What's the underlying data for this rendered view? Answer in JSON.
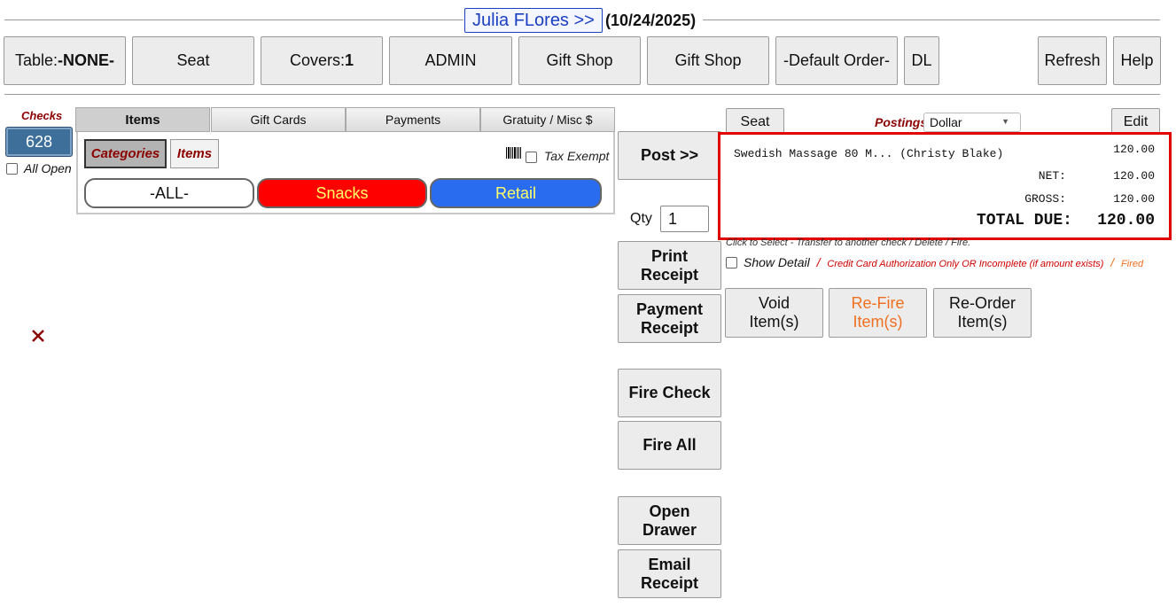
{
  "header": {
    "customer_link": "Julia FLores >>",
    "date": "(10/24/2025)",
    "colors": {
      "link": "#1a3fbf",
      "link_border": "#1a3fbf"
    }
  },
  "toolbar": {
    "table_label": "Table: ",
    "table_value": "-NONE-",
    "seat": "Seat",
    "covers_label": "Covers: ",
    "covers_value": "1",
    "admin": "ADMIN",
    "gift_shop_1": "Gift Shop",
    "gift_shop_2": "Gift Shop",
    "default_order": "-Default Order-",
    "dl": "DL",
    "refresh": "Refresh",
    "help": "Help"
  },
  "checks": {
    "title": "Checks",
    "check_number": "628",
    "all_open": "All Open",
    "colors": {
      "title": "#8b0000",
      "badge": "#3e6f9b"
    }
  },
  "tabs": [
    {
      "label": "Items",
      "active": true
    },
    {
      "label": "Gift Cards",
      "active": false
    },
    {
      "label": "Payments",
      "active": false
    },
    {
      "label": "Gratuity / Misc $",
      "active": false
    }
  ],
  "item_panel": {
    "categories_btn": "Categories",
    "items_btn": "Items",
    "barcode_icon": "barcode-icon",
    "tax_exempt": "Tax Exempt",
    "category_pills": [
      {
        "label": "-ALL-",
        "bg": "#ffffff",
        "color": "#111111"
      },
      {
        "label": "Snacks",
        "bg": "#ff0000",
        "color": "#ffff66"
      },
      {
        "label": "Retail",
        "bg": "#2a6cf0",
        "color": "#ffff66"
      }
    ]
  },
  "remove_icon": "close-x-icon",
  "actions": {
    "post": "Post >>",
    "qty_label": "Qty",
    "qty_value": "1",
    "print_receipt_1": "Print",
    "print_receipt_2": "Receipt",
    "payment_receipt_1": "Payment",
    "payment_receipt_2": "Receipt",
    "fire_check": "Fire Check",
    "fire_all": "Fire All",
    "open_drawer_1": "Open",
    "open_drawer_2": "Drawer",
    "email_receipt_1": "Email",
    "email_receipt_2": "Receipt"
  },
  "check_panel": {
    "seat": "Seat",
    "postings_label": "Postings",
    "postings_select": "Dollar",
    "edit": "Edit",
    "line_items": [
      {
        "description": "Swedish Massage 80 M... (Christy Blake)",
        "amount": "120.00"
      }
    ],
    "net_label": "NET:",
    "net_value": "120.00",
    "gross_label": "GROSS:",
    "gross_value": "120.00",
    "total_label": "TOTAL DUE:",
    "total_value": "120.00",
    "hint": "Click to Select - Transfer to another check / Delete / Fire.",
    "show_detail": "Show Detail",
    "legend_sep": "/",
    "legend_cc": "Credit Card Authorization Only OR Incomplete (if amount exists)",
    "legend_fired": "Fired",
    "colors": {
      "highlight_border": "#e00000",
      "cc": "#d00000",
      "fired": "#f07020"
    }
  },
  "item_actions": {
    "void_1": "Void",
    "void_2": "Item(s)",
    "refire_1": "Re-Fire",
    "refire_2": "Item(s)",
    "reorder_1": "Re-Order",
    "reorder_2": "Item(s)"
  }
}
